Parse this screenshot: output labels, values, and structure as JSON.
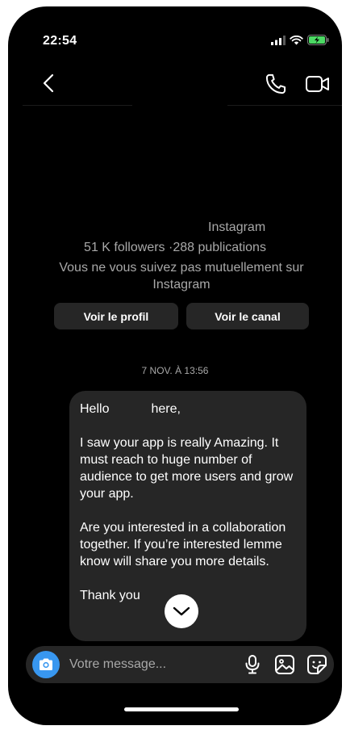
{
  "status_bar": {
    "time": "22:54"
  },
  "header": {
    "back_icon": "chevron-left-icon",
    "call_icon": "phone-icon",
    "video_icon": "video-camera-icon"
  },
  "profile": {
    "name": "Instagram",
    "stats": "51 K followers ·288 publications",
    "mutual_note": "Vous ne vous suivez pas mutuellement sur Instagram",
    "view_profile_label": "Voir le profil",
    "view_channel_label": "Voir le canal"
  },
  "conversation": {
    "date_separator": "7 NOV. À 13:56",
    "message": {
      "greeting_start": "Hello",
      "greeting_end": "here,",
      "paragraph_1": "I saw your app is really Amazing. It must reach to huge number of audience to get more users and grow your app.",
      "paragraph_2": "Are you interested in a collaboration together. If you’re interested lemme know will share you more details.",
      "closing": "Thank you"
    }
  },
  "composer": {
    "placeholder": "Votre message...",
    "camera_icon": "camera-icon",
    "mic_icon": "microphone-icon",
    "gallery_icon": "image-icon",
    "sticker_icon": "sticker-icon"
  },
  "colors": {
    "background": "#000000",
    "surface": "#262626",
    "muted_text": "#a8a8a8",
    "accent": "#3897f0",
    "battery": "#4cd964"
  }
}
